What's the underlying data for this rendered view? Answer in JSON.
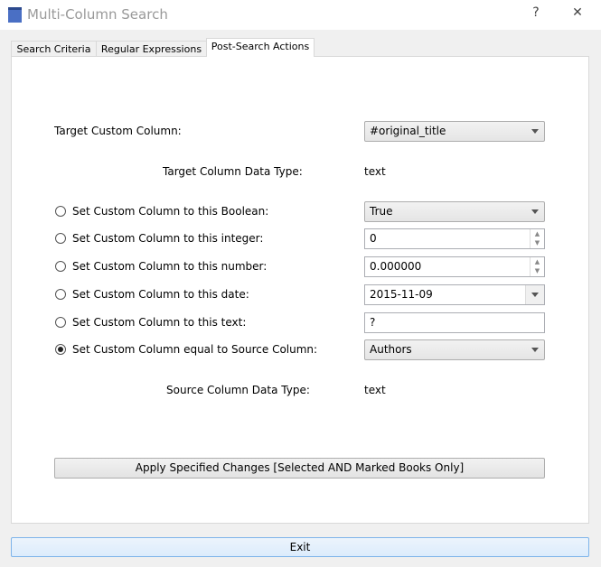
{
  "window": {
    "title": "Multi-Column Search",
    "help": "?",
    "close": "✕"
  },
  "tabs": [
    {
      "label": "Search Criteria"
    },
    {
      "label": "Regular Expressions"
    },
    {
      "label": "Post-Search Actions"
    }
  ],
  "target": {
    "label": "Target Custom Column:",
    "value": "#original_title",
    "type_label": "Target Column Data Type:",
    "type_value": "text"
  },
  "options": [
    {
      "label": "Set Custom Column to this Boolean:",
      "value": "True",
      "selected": false
    },
    {
      "label": "Set Custom Column to this integer:",
      "value": "0",
      "selected": false
    },
    {
      "label": "Set Custom Column to this number:",
      "value": "0.000000",
      "selected": false
    },
    {
      "label": "Set Custom Column to this date:",
      "value": "2015-11-09",
      "selected": false
    },
    {
      "label": "Set Custom Column to this text:",
      "value": "?",
      "selected": false
    },
    {
      "label": "Set Custom Column equal to Source Column:",
      "value": "Authors",
      "selected": true
    }
  ],
  "source": {
    "type_label": "Source Column Data Type:",
    "type_value": "text"
  },
  "apply_label": "Apply Specified Changes [Selected AND Marked Books Only]",
  "exit_label": "Exit"
}
